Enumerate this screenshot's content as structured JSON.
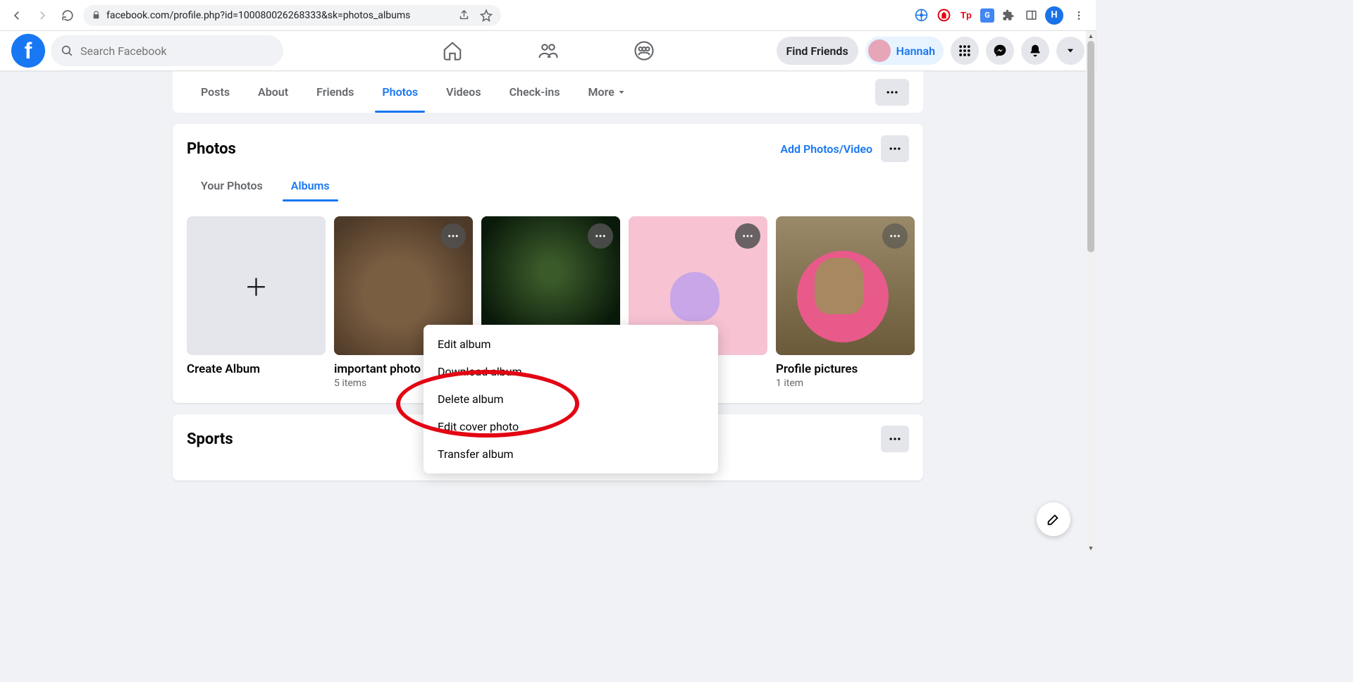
{
  "browser": {
    "url": "facebook.com/profile.php?id=100080026268333&sk=photos_albums",
    "ext_letter": "H"
  },
  "header": {
    "search_placeholder": "Search Facebook",
    "find_friends": "Find Friends",
    "user_name": "Hannah"
  },
  "profile_tabs": {
    "items": [
      "Posts",
      "About",
      "Friends",
      "Photos",
      "Videos",
      "Check-ins",
      "More"
    ],
    "active_index": 3
  },
  "photos_card": {
    "title": "Photos",
    "add_link": "Add Photos/Video",
    "subtabs": [
      "Your Photos",
      "Albums"
    ],
    "active_sub": 1,
    "create_label": "Create Album",
    "albums": [
      {
        "title": "important photo",
        "count": "5 items"
      },
      {
        "title": "",
        "count": ""
      },
      {
        "title": "",
        "count": ""
      },
      {
        "title": "Profile pictures",
        "count": "1 item"
      }
    ]
  },
  "context_menu": {
    "items": [
      "Edit album",
      "Download album",
      "Delete album",
      "Edit cover photo",
      "Transfer album"
    ]
  },
  "sports_card": {
    "title": "Sports"
  }
}
